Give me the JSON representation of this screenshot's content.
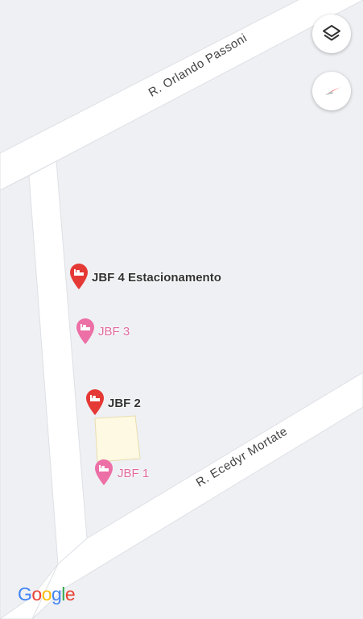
{
  "streets": {
    "top": "R. Orlando Passoni",
    "bottom": "R. Ecedyr Mortate"
  },
  "places": [
    {
      "name": "JBF 4 Estacionamento",
      "kind": "hotel",
      "color": "#e53935",
      "label_color": "#333333"
    },
    {
      "name": "JBF 3",
      "kind": "hotel",
      "color": "#ec6fa6",
      "label_color": "#e06aa0"
    },
    {
      "name": "JBF 2",
      "kind": "hotel",
      "color": "#e53935",
      "label_color": "#333333"
    },
    {
      "name": "JBF 1",
      "kind": "hotel",
      "color": "#ec6fa6",
      "label_color": "#e06aa0"
    }
  ],
  "controls": {
    "layers_icon": "layers-icon",
    "compass_icon": "compass-icon"
  },
  "attribution": {
    "logo_letters": [
      {
        "ch": "G",
        "color": "#4285f4"
      },
      {
        "ch": "o",
        "color": "#ea4335"
      },
      {
        "ch": "o",
        "color": "#fbbc05"
      },
      {
        "ch": "g",
        "color": "#4285f4"
      },
      {
        "ch": "l",
        "color": "#34a853"
      },
      {
        "ch": "e",
        "color": "#ea4335"
      }
    ]
  }
}
